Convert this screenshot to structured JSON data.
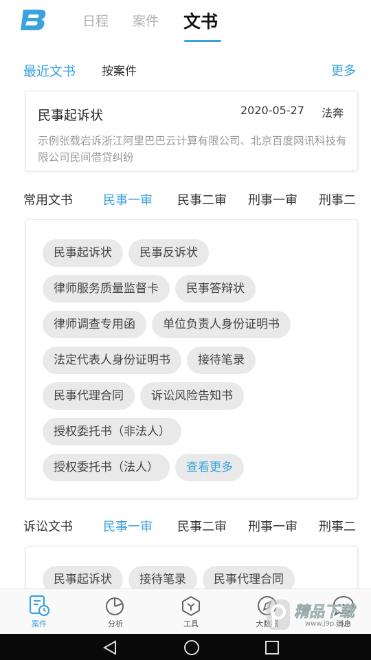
{
  "header": {
    "tabs": [
      "日程",
      "案件",
      "文书"
    ],
    "active_tab": "文书"
  },
  "recent": {
    "title": "最近文书",
    "by_case": "按案件",
    "more": "更多",
    "card": {
      "title": "民事起诉状",
      "date": "2020-05-27",
      "user": "法奔",
      "desc": "示例张载岩诉浙江阿里巴巴云计算有限公司、北京百度网讯科技有限公司民间借贷纠纷"
    }
  },
  "common": {
    "title": "常用文书",
    "tabs": [
      "民事一审",
      "民事二审",
      "刑事一审",
      "刑事二"
    ],
    "chips": [
      [
        "民事起诉状",
        "民事反诉状"
      ],
      [
        "律师服务质量监督卡",
        "民事答辩状"
      ],
      [
        "律师调查专用函",
        "单位负责人身份证明书"
      ],
      [
        "法定代表人身份证明书",
        "接待笔录"
      ],
      [
        "民事代理合同",
        "诉讼风险告知书"
      ],
      [
        "授权委托书（非法人）"
      ],
      [
        "授权委托书（法人）"
      ]
    ],
    "see_more": "查看更多"
  },
  "litigation": {
    "title": "诉讼文书",
    "tabs": [
      "民事一审",
      "民事二审",
      "刑事一审",
      "刑事二"
    ],
    "chips": [
      "民事起诉状",
      "接待笔录",
      "民事代理合同"
    ]
  },
  "bottom_nav": [
    {
      "label": "案件",
      "icon": "case-icon",
      "active": true
    },
    {
      "label": "分析",
      "icon": "pie-chart-icon",
      "active": false
    },
    {
      "label": "工具",
      "icon": "tool-icon",
      "active": false
    },
    {
      "label": "大数据",
      "icon": "compass-icon",
      "active": false
    },
    {
      "label": "消息",
      "icon": "message-icon",
      "active": false
    }
  ],
  "watermark": {
    "text": "精品下载",
    "url": "www.j9p.com"
  },
  "colors": {
    "accent": "#3aa2dc",
    "chip_bg": "#e9e9e9",
    "muted": "#9a9a9a"
  }
}
